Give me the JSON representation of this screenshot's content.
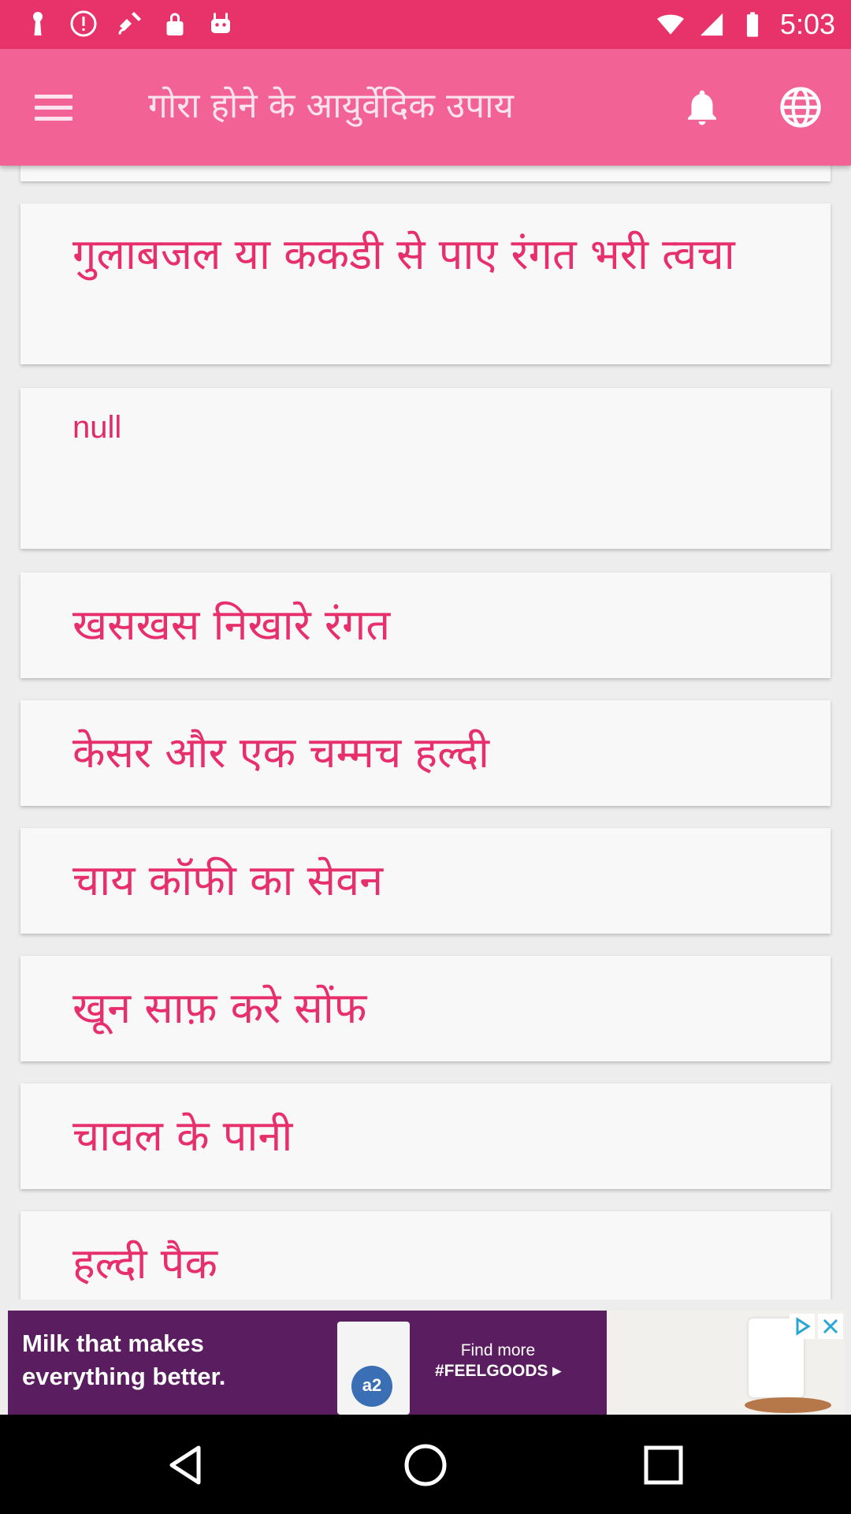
{
  "status_bar": {
    "time": "5:03"
  },
  "app_bar": {
    "title": "गोरा होने के आयुर्वेदिक उपाय"
  },
  "list": {
    "items": [
      {
        "label": ""
      },
      {
        "label": "गुलाबजल या ककडी से पाए रंगत भरी त्वचा"
      },
      {
        "label": "null"
      },
      {
        "label": "खसखस निखारे रंगत"
      },
      {
        "label": "केसर और एक चम्मच हल्दी"
      },
      {
        "label": "चाय कॉफी का सेवन"
      },
      {
        "label": "खून साफ़ करे सोंफ"
      },
      {
        "label": "चावल के पानी"
      },
      {
        "label": "हल्दी पैक"
      }
    ]
  },
  "ad": {
    "line1": "Milk that makes",
    "line2": "everything better.",
    "find_more": "Find more",
    "hashtag": "#FEELGOODS ▸",
    "logo": "a2"
  },
  "colors": {
    "status_bar": "#e8326a",
    "app_bar": "#f26294",
    "accent_text": "#e72f6c",
    "card_bg": "#f8f8f8"
  },
  "icons": [
    "menu-icon",
    "bell-icon",
    "globe-icon",
    "back-icon",
    "home-icon",
    "recents-icon"
  ]
}
